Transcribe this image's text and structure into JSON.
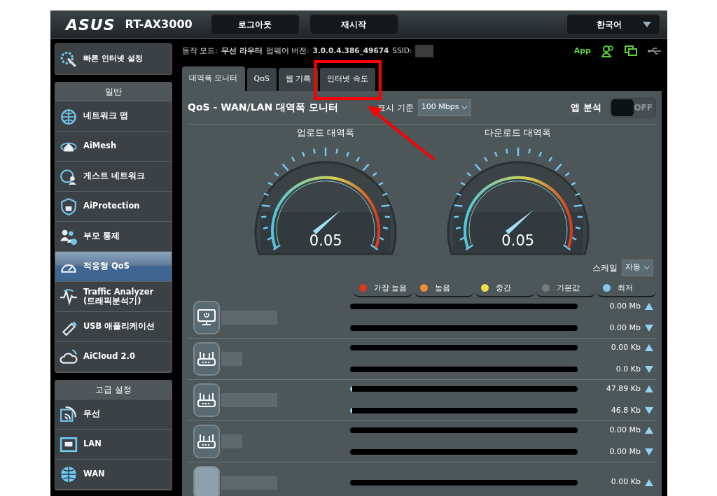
{
  "header": {
    "logo": "ASUS",
    "model": "RT-AX3000",
    "buttons": [
      "로그아웃",
      "재시작"
    ],
    "language": "한국어"
  },
  "sidebar": {
    "quick_setup": {
      "label": "빠른 인터넷 설정"
    },
    "sections": [
      {
        "title": "일반",
        "items": [
          {
            "label": "네트워크 맵",
            "selected": false
          },
          {
            "label": "AiMesh",
            "selected": false
          },
          {
            "label": "게스트 네트워크",
            "selected": false
          },
          {
            "label": "AiProtection",
            "selected": false
          },
          {
            "label": "부모 통제",
            "selected": false
          },
          {
            "label": "적응형 QoS",
            "selected": true
          },
          {
            "label": "Traffic Analyzer\n(트래픽분석기)",
            "selected": false
          },
          {
            "label": "USB 애플리케이션",
            "selected": false
          },
          {
            "label": "AiCloud 2.0",
            "selected": false
          }
        ]
      },
      {
        "title": "고급 설정",
        "items": [
          {
            "label": "무선",
            "selected": false
          },
          {
            "label": "LAN",
            "selected": false
          },
          {
            "label": "WAN",
            "selected": false
          }
        ]
      }
    ]
  },
  "status": {
    "mode_label": "동작 모드:",
    "mode": "무선 라우터",
    "firmware_label": "펌웨어 버전:",
    "firmware": "3.0.0.4.386_49674",
    "ssid_label": "SSID:",
    "app": "App"
  },
  "tabs": [
    {
      "label": "대역폭 모니터",
      "selected": true
    },
    {
      "label": "QoS",
      "selected": false
    },
    {
      "label": "웹 기록",
      "selected": false
    },
    {
      "label": "인터넷 속도",
      "selected": false
    }
  ],
  "panel": {
    "title": "QoS - WAN/LAN 대역폭 모니터",
    "display_label": "표시 기준",
    "display_value": "100 Mbps",
    "app_analysis_label": "앱 분석",
    "app_analysis": {
      "on": false,
      "off_text": "OFF"
    },
    "gauges": [
      {
        "title": "업로드 대역폭",
        "value": "0.05"
      },
      {
        "title": "다운로드 대역폭",
        "value": "0.05"
      }
    ],
    "scale_label": "스케일",
    "scale_value": "자동",
    "legend": [
      {
        "label": "가장 높음",
        "color": "#d9391f"
      },
      {
        "label": "높음",
        "color": "#e59033"
      },
      {
        "label": "중간",
        "color": "#f0df4b"
      },
      {
        "label": "기본값",
        "color": "#7a7a7a"
      },
      {
        "label": "최저",
        "color": "#7fc9ef"
      }
    ],
    "clients": [
      {
        "kind": "monitor",
        "up": {
          "level": 0,
          "reading": "0.00 Mb"
        },
        "down": {
          "level": 0,
          "reading": "0.00 Mb"
        }
      },
      {
        "kind": "router",
        "up": {
          "level": 0,
          "reading": "0.00 Kb"
        },
        "down": {
          "level": 0,
          "reading": "0.0 Kb"
        }
      },
      {
        "kind": "router",
        "up": {
          "level": 0.01,
          "reading": "47.89 Kb"
        },
        "down": {
          "level": 0.01,
          "reading": "46.8 Kb"
        }
      },
      {
        "kind": "router",
        "up": {
          "level": 0,
          "reading": "0.00 Mb"
        },
        "down": {
          "level": 0,
          "reading": "0.00 Mb"
        }
      },
      {
        "kind": "device",
        "up": {
          "level": 0,
          "reading": "0.00 Kb"
        }
      }
    ]
  }
}
